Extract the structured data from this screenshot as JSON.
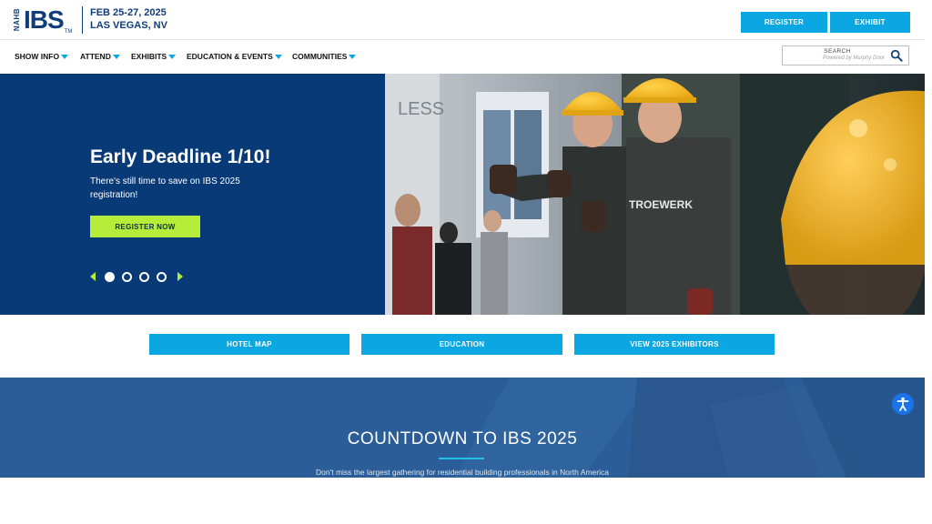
{
  "header": {
    "logo_org": "NAHB",
    "logo_text": "IBS",
    "logo_tm": "TM",
    "event_dates": "FEB 25-27, 2025",
    "event_location": "LAS VEGAS, NV",
    "register_label": "REGISTER",
    "exhibit_label": "EXHIBIT"
  },
  "nav": {
    "items": [
      {
        "label": "SHOW INFO"
      },
      {
        "label": "ATTEND"
      },
      {
        "label": "EXHIBITS"
      },
      {
        "label": "EDUCATION & EVENTS"
      },
      {
        "label": "COMMUNITIES"
      }
    ]
  },
  "search": {
    "label": "SEARCH",
    "powered_by": "Powered by Murphy Door"
  },
  "hero": {
    "title": "Early Deadline 1/10!",
    "text": "There's still time to save on IBS 2025 registration!",
    "button_label": "REGISTER NOW",
    "slide_count": 4,
    "active_slide": 1,
    "photo_shirt_text": "TROEWERK"
  },
  "quick_links": [
    {
      "label": "HOTEL MAP"
    },
    {
      "label": "EDUCATION"
    },
    {
      "label": "VIEW 2025 EXHIBITORS"
    }
  ],
  "countdown": {
    "title": "COUNTDOWN TO IBS 2025",
    "subtitle": "Don't miss the largest gathering for residential building professionals in North America"
  },
  "colors": {
    "brand_navy": "#073a77",
    "accent_blue": "#0aa7e3",
    "accent_green": "#b6ec3a",
    "countdown_bg": "#2c5f99",
    "accessibility_blue": "#1a73e8"
  },
  "icons": {
    "search": "search-icon",
    "accessibility": "accessibility-icon"
  }
}
